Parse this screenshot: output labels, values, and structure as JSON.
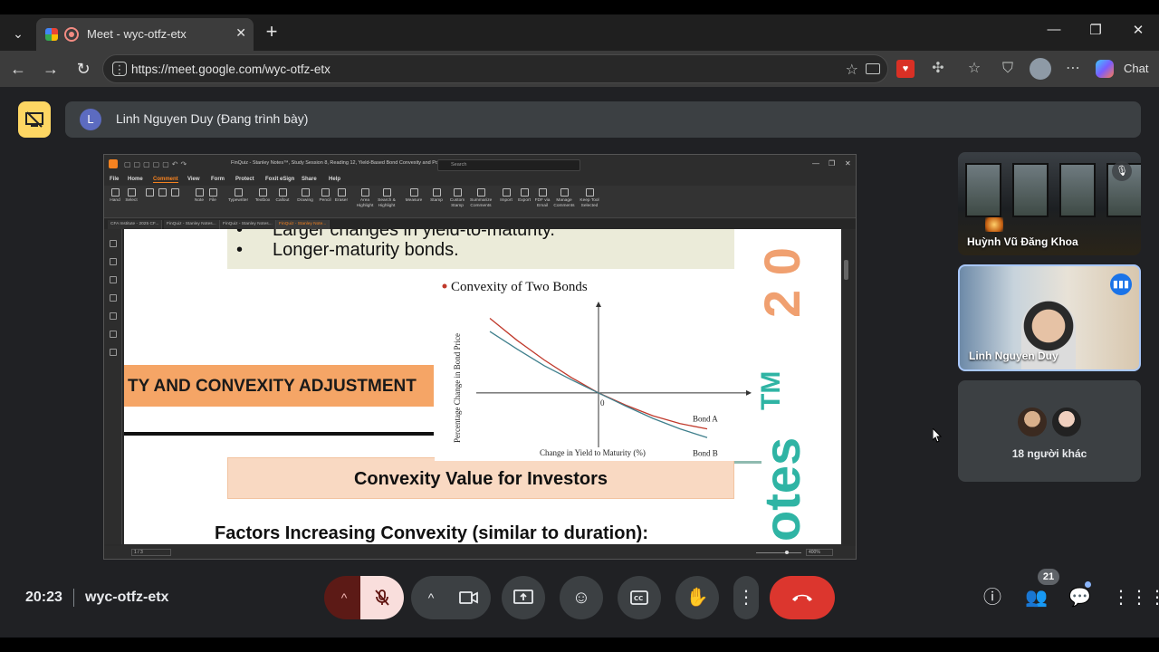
{
  "browser": {
    "tab_title": "Meet - wyc-otfz-etx",
    "url": "https://meet.google.com/wyc-otfz-etx",
    "chat_label": "Chat"
  },
  "meet": {
    "presenter_initial": "L",
    "presenter_label": "Linh Nguyen Duy (Đang trình bày)",
    "time": "20:23",
    "meeting_code": "wyc-otfz-etx",
    "people_count": "21",
    "participants": [
      {
        "name": "Huỳnh Vũ Đăng Khoa"
      },
      {
        "name": "Linh Nguyen Duy"
      }
    ],
    "others_label": "18 người khác"
  },
  "foxit": {
    "doc_title": "FinQuiz - Stanley Notes™, Study Session 8, Reading 12, Yield-Based Bond Convexity and Portfolio Pr...",
    "search_placeholder": "Search",
    "menu": [
      "File",
      "Home",
      "Comment",
      "View",
      "Form",
      "Protect",
      "Foxit eSign",
      "Share",
      "Help"
    ],
    "active_menu": "Comment",
    "ribbon": [
      "Hand",
      "Select",
      "",
      "",
      "",
      "Note",
      "File",
      "Typewriter",
      "Textbox",
      "Callout",
      "Drawing",
      "Pencil",
      "Eraser",
      "Area Highlight",
      "Search & Highlight",
      "Measure",
      "Stamp",
      "Custom Stamp",
      "Summarize Comments",
      "Import",
      "Export",
      "FDF via Email",
      "Manage Comments",
      "Keep Tool Selected"
    ],
    "doc_tabs": [
      "CFA Institute - 2025 CF...",
      "FinQuiz - Stanley Notes...",
      "FinQuiz - Stanley Notes...",
      "FinQuiz - Stanley Note..."
    ],
    "page_indicator": "1 / 3",
    "zoom": "400%"
  },
  "slide": {
    "bullet1": "Larger changes in yield-to-maturity.",
    "bullet2": "Longer-maturity bonds.",
    "banner": "TY AND CONVEXITY ADJUSTMENT",
    "section_title": "Convexity Value for Investors",
    "factors": "Factors Increasing Convexity (similar to duration):",
    "watermark_notes": "otes",
    "watermark_tm": "TM",
    "watermark_num": "2 0"
  },
  "chart_data": {
    "type": "line",
    "title": "Convexity of Two Bonds",
    "xlabel": "Change in Yield to Maturity (%)",
    "ylabel": "Percentage Change in Bond Price",
    "origin_label": "0",
    "series": [
      {
        "name": "Bond A",
        "color": "#c0392b",
        "points": [
          [
            -4,
            1.7
          ],
          [
            -3,
            1.2
          ],
          [
            -2,
            0.75
          ],
          [
            -1,
            0.35
          ],
          [
            0,
            0
          ],
          [
            1,
            -0.28
          ],
          [
            2,
            -0.52
          ],
          [
            3,
            -0.7
          ],
          [
            4,
            -0.82
          ]
        ]
      },
      {
        "name": "Bond B",
        "color": "#3f7f8c",
        "points": [
          [
            -4,
            1.4
          ],
          [
            -3,
            1.0
          ],
          [
            -2,
            0.62
          ],
          [
            -1,
            0.3
          ],
          [
            0,
            0
          ],
          [
            1,
            -0.3
          ],
          [
            2,
            -0.58
          ],
          [
            3,
            -0.82
          ],
          [
            4,
            -1.02
          ]
        ]
      }
    ],
    "xlim": [
      -4.5,
      5.5
    ],
    "ylim": [
      -1.2,
      2.0
    ]
  }
}
